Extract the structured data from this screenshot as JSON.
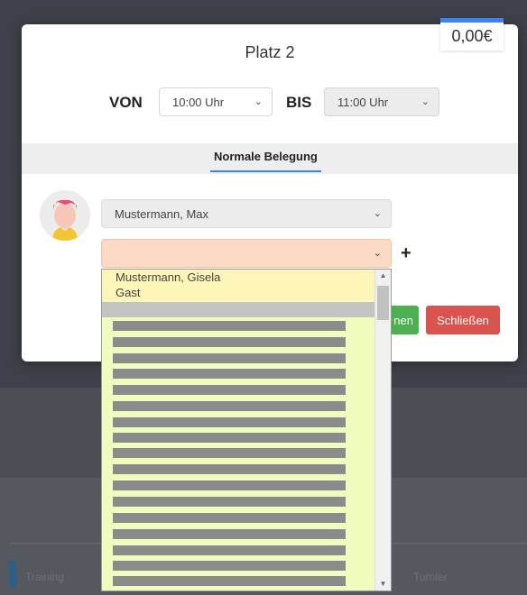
{
  "modal": {
    "price": "0,00€",
    "title": "Platz 2",
    "from_label": "VON",
    "from_value": "10:00 Uhr",
    "to_label": "BIS",
    "to_value": "11:00 Uhr",
    "tab_active": "Normale Belegung",
    "player1": "Mustermann, Max",
    "player2": "",
    "add_icon": "+",
    "save_partial": "nen",
    "close_label": "Schließen"
  },
  "dropdown": {
    "options": [
      "Mustermann, Gisela",
      "Gast"
    ],
    "redacted_count": 16
  },
  "background": {
    "tab_left": "Training",
    "tab_right": "Turnier"
  }
}
